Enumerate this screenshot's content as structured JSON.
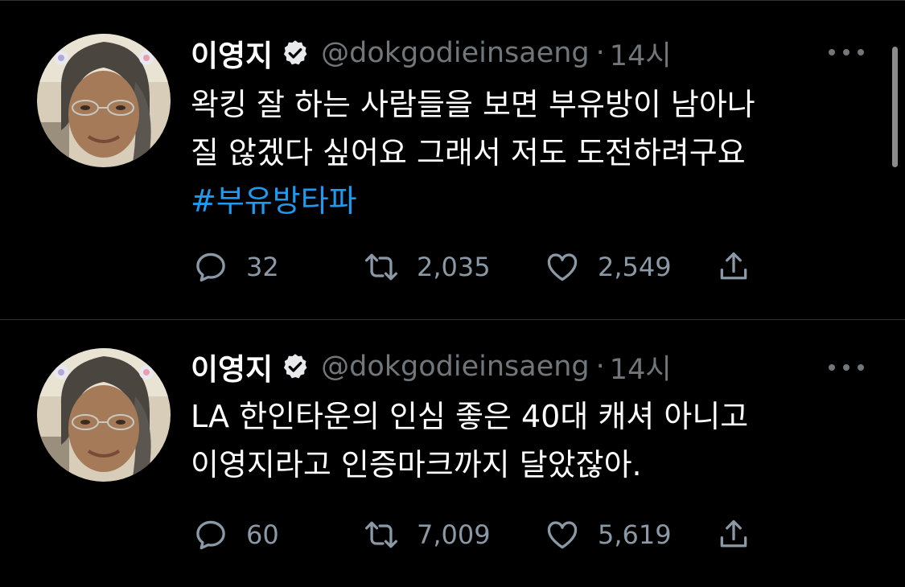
{
  "tweets": [
    {
      "author": {
        "display_name": "이영지",
        "verified_icon": "verified-badge-icon",
        "handle": "@dokgodieinsaeng",
        "separator": "·",
        "time": "14시"
      },
      "text_lines": [
        "왁킹 잘 하는 사람들을 보면 부유방이 남아나",
        "질 않겠다 싶어요 그래서 저도 도전하려구요"
      ],
      "hashtag": "#부유방타파",
      "stats": {
        "replies": "32",
        "retweets": "2,035",
        "likes": "2,549"
      }
    },
    {
      "author": {
        "display_name": "이영지",
        "verified_icon": "verified-badge-icon",
        "handle": "@dokgodieinsaeng",
        "separator": "·",
        "time": "14시"
      },
      "text_lines": [
        "LA 한인타운의 인심 좋은 40대 캐셔 아니고",
        "이영지라고 인증마크까지 달았잖아."
      ],
      "stats": {
        "replies": "60",
        "retweets": "7,009",
        "likes": "5,619"
      }
    }
  ],
  "icons": {
    "reply": "reply-icon",
    "retweet": "retweet-icon",
    "like": "heart-icon",
    "share": "share-icon",
    "more": "more-icon"
  },
  "colors": {
    "background": "#000000",
    "text": "#ffffff",
    "secondary": "#71767b",
    "hashtag": "#1d9bf0",
    "divider": "#2f3336"
  }
}
